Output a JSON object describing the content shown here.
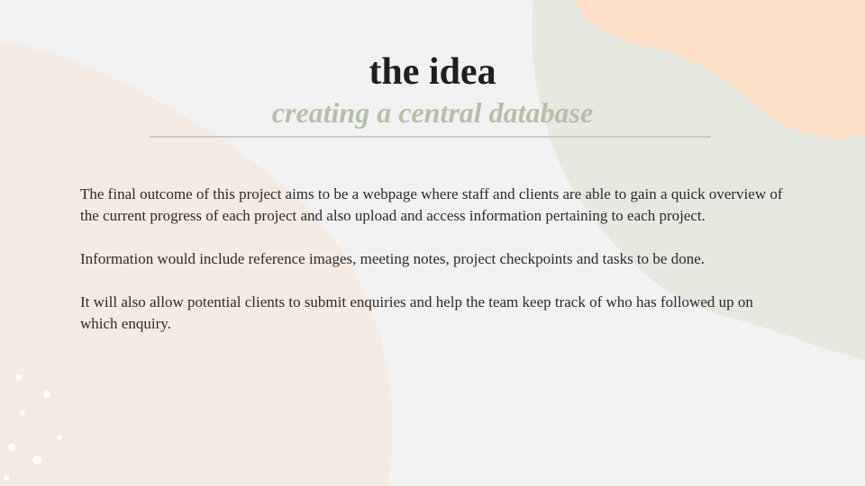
{
  "slide": {
    "title": "the idea",
    "subtitle": "creating a central database",
    "paragraphs": [
      "The final outcome of this project aims to be a webpage where staff and clients are able to gain a quick overview of the current progress of each project and also upload and access information pertaining to each project.",
      "Information would include reference images, meeting notes, project checkpoints and tasks to be done.",
      "It will also allow potential clients to submit enquiries and help the team keep track of who has followed up on which enquiry."
    ]
  },
  "colors": {
    "background": "#f2f2f2",
    "peach_blob_left": "#f6ebe2",
    "sage_blob_right": "#e7e8e0",
    "peach_blob_top_right": "#fde1c8",
    "subtitle_accent": "#b7bfa6",
    "title_text": "#1f1f1f"
  }
}
